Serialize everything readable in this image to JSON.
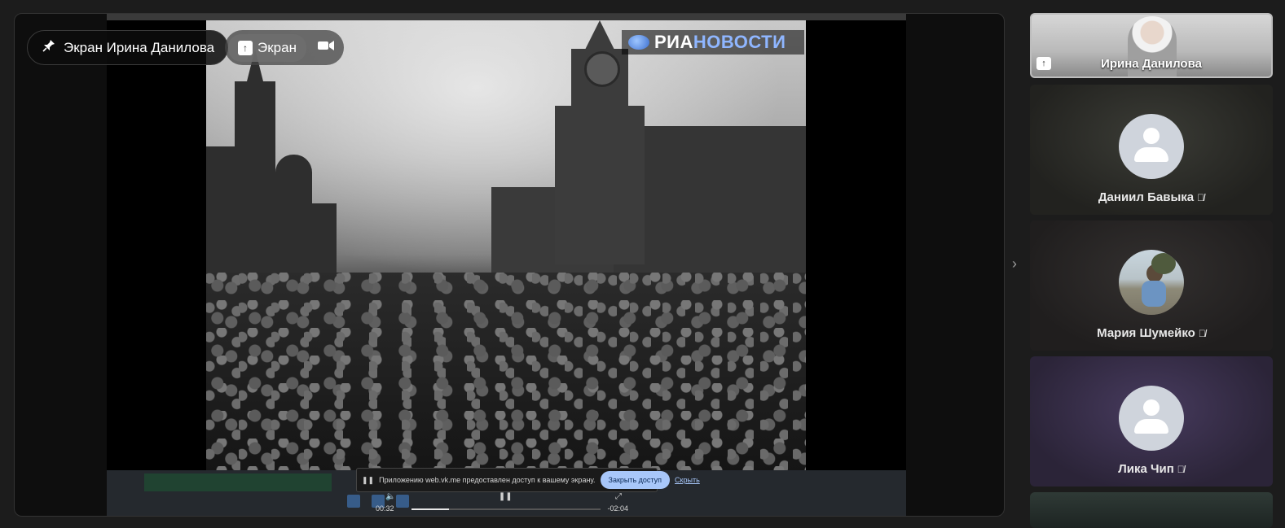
{
  "pinned_label": "Экран Ирина Данилова",
  "controls": {
    "screen_label": "Экран"
  },
  "video": {
    "watermark_part1": "РИА",
    "watermark_part2": "НОВОСТИ"
  },
  "player": {
    "current_time": "00:32",
    "remaining_time": "-02:04",
    "progress": 0.2
  },
  "share_notice": {
    "text": "Приложению web.vk.me предоставлен доступ к вашему экрану.",
    "stop_button": "Закрыть доступ",
    "hide_link": "Скрыть"
  },
  "participants": [
    {
      "name": "Ирина Данилова",
      "avatar": "photo",
      "sharing": true
    },
    {
      "name": "Даниил Бавыка",
      "avatar": "default",
      "muted": true
    },
    {
      "name": "Мария Шумейко",
      "avatar": "photo",
      "muted": true
    },
    {
      "name": "Лика Чип",
      "avatar": "default",
      "muted": true
    }
  ],
  "colors": {
    "accent": "#a8c7fa",
    "stage_bg": "#0e0e0e",
    "page_bg": "#1c1c1c"
  }
}
